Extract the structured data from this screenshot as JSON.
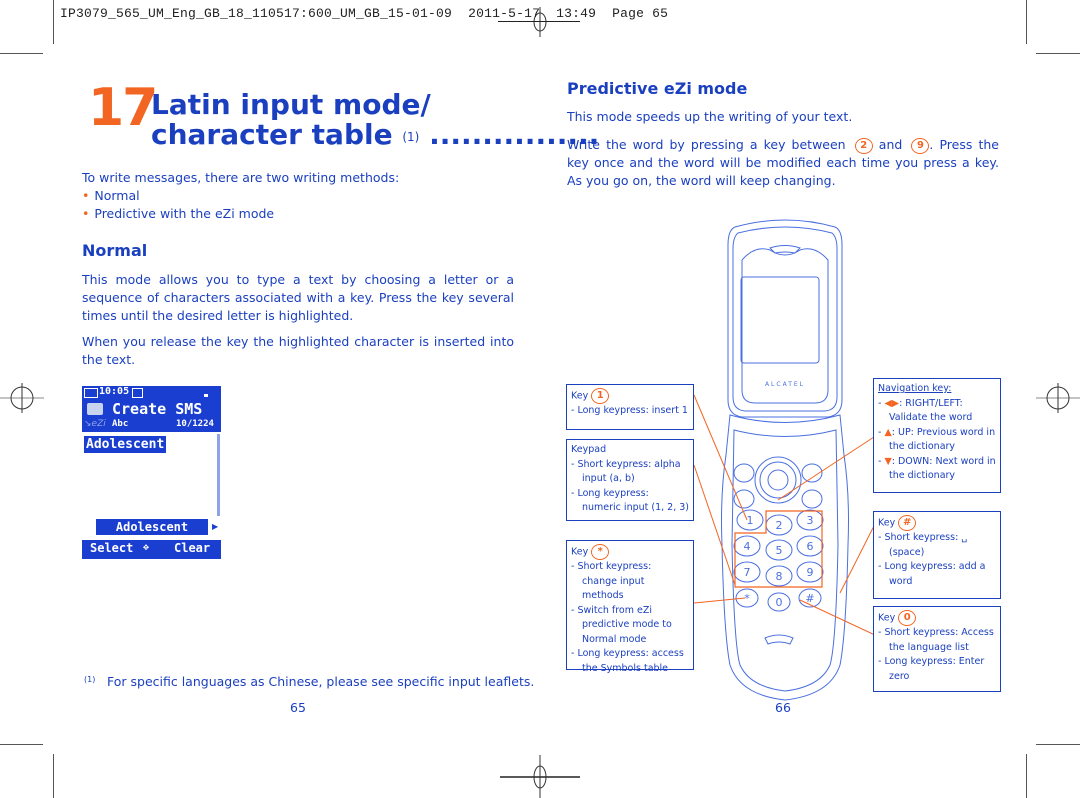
{
  "print_header": {
    "text": "IP3079_565_UM_Eng_GB_18_110517:600_UM_GB_15-01-09  2011-5-17  13:49  Page 65"
  },
  "left_page": {
    "chapter_number": "17",
    "chapter_title_line1": "Latin input mode/",
    "chapter_title_line2": "character table",
    "chapter_title_footnote_ref": "(1)",
    "chapter_title_leader": "................",
    "intro": "To write messages, there are two writing methods:",
    "methods": [
      "Normal",
      "Predictive with the eZi mode"
    ],
    "normal_heading": "Normal",
    "normal_para1": "This mode allows you to type a text by choosing a letter or a sequence of characters associated with a key. Press the key several times until the desired letter is highlighted.",
    "normal_para2": "When you release the key the highlighted character is inserted into the text.",
    "phone_screen": {
      "time": "10:05",
      "title": "Create SMS",
      "input_mode": "Abc",
      "counter": "10/1224",
      "typed_word": "Adolescent",
      "candidate_word": "Adolescent",
      "softkey_left": "Select",
      "softkey_right": "Clear"
    },
    "footnote_marker": "(1)",
    "footnote": "For specific languages as Chinese, please see specific input leaflets.",
    "page_number": "65"
  },
  "right_page": {
    "heading": "Predictive eZi mode",
    "para1": "This mode speeds up the writing of your text.",
    "para2_part1": "Write the word by pressing a key between",
    "key_from": "2",
    "para2_and": "and",
    "key_to": "9",
    "para2_part2": ". Press the key once and the word will be modified each time you press a key. As you go on, the word will keep changing.",
    "phone_brand": "ALCATEL",
    "callouts": {
      "key1": {
        "label": "Key",
        "key": "1",
        "items": [
          "Long keypress: insert 1"
        ]
      },
      "keypad": {
        "label": "Keypad",
        "items": [
          "Short keypress: alpha input (a, b)",
          "Long keypress: numeric input (1, 2, 3)"
        ]
      },
      "key_star": {
        "label": "Key",
        "key": "*",
        "items": [
          "Short keypress: change input methods",
          "Switch from eZi predictive mode to Normal mode",
          "Long keypress: access the Symbols table"
        ]
      },
      "navigation": {
        "label": "Navigation key:",
        "items": [
          {
            "arrow": "◀▶",
            "text": ": RIGHT/LEFT: Validate the word"
          },
          {
            "arrow": "▲",
            "text": ": UP: Previous word in the dictionary"
          },
          {
            "arrow": "▼",
            "text": ": DOWN: Next word in the dictionary"
          }
        ]
      },
      "key_hash": {
        "label": "Key",
        "key": "#",
        "items": [
          "Short keypress: ␣ (space)",
          "Long keypress: add a word"
        ]
      },
      "key0": {
        "label": "Key",
        "key": "0",
        "items": [
          "Short keypress: Access the language list",
          "Long keypress: Enter zero"
        ]
      }
    },
    "page_number": "66"
  },
  "colors": {
    "text_blue": "#1a3fbf",
    "accent_orange": "#f26522",
    "lcd_blue": "#1a3fd0"
  }
}
